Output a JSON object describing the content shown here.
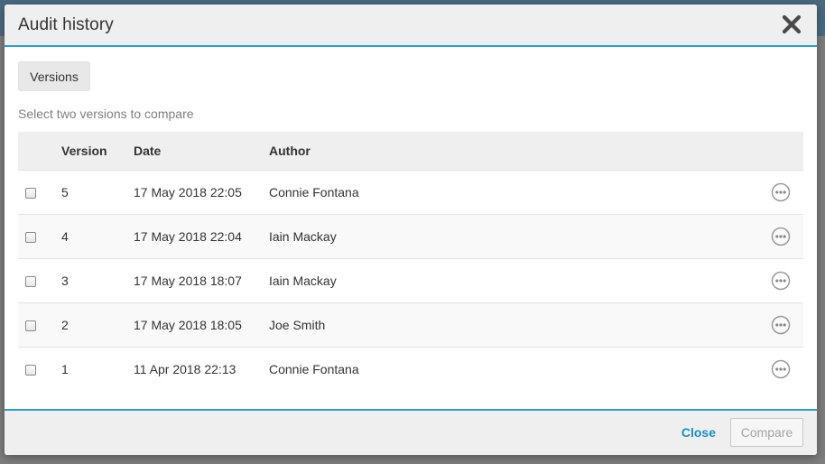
{
  "modal": {
    "title": "Audit history",
    "versions_button": "Versions",
    "hint": "Select two versions to compare"
  },
  "table": {
    "headers": {
      "version": "Version",
      "date": "Date",
      "author": "Author"
    },
    "rows": [
      {
        "version": "5",
        "date": "17 May 2018 22:05",
        "author": "Connie Fontana"
      },
      {
        "version": "4",
        "date": "17 May 2018 22:04",
        "author": "Iain Mackay"
      },
      {
        "version": "3",
        "date": "17 May 2018 18:07",
        "author": "Iain Mackay"
      },
      {
        "version": "2",
        "date": "17 May 2018 18:05",
        "author": "Joe Smith"
      },
      {
        "version": "1",
        "date": "11 Apr 2018 22:13",
        "author": "Connie Fontana"
      }
    ]
  },
  "footer": {
    "close_label": "Close",
    "compare_label": "Compare"
  },
  "colors": {
    "accent": "#2a9fd0",
    "link": "#1b8fc6"
  },
  "icons": {
    "close": "close-icon",
    "row_menu": "more-options-icon"
  }
}
